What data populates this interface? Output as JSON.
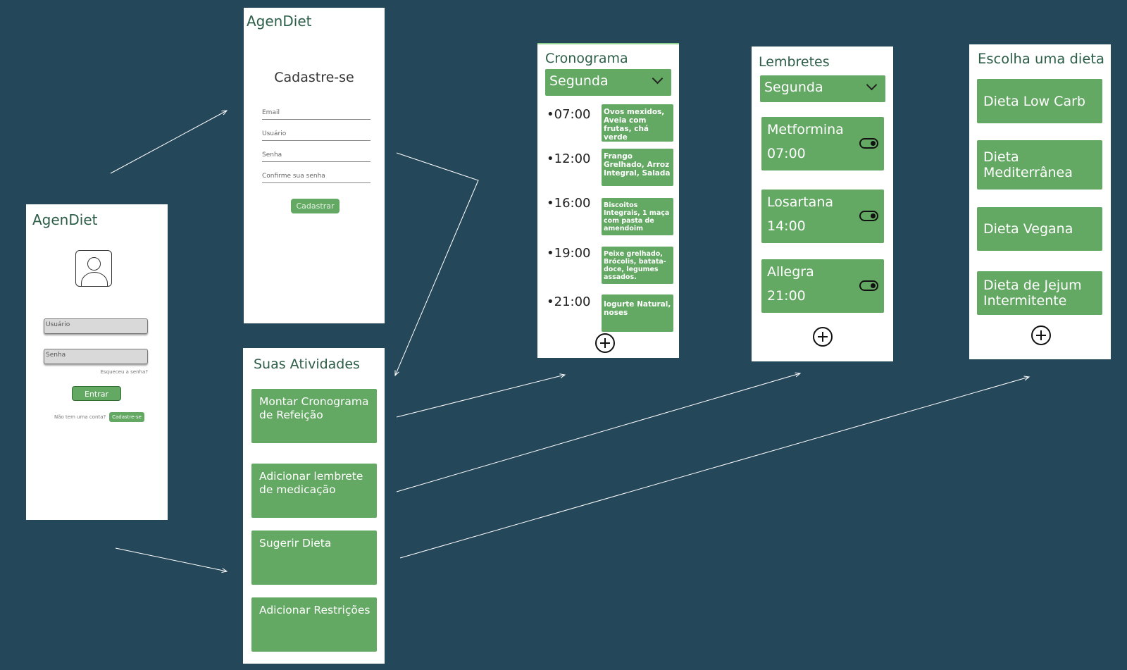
{
  "login": {
    "app_name": "AgenDiet",
    "username_placeholder": "Usuário",
    "password_placeholder": "Senha",
    "forgot_password": "Esqueceu a senha?",
    "login_button": "Entrar",
    "no_account": "Não tem uma conta?",
    "signup_button": "Cadastre-se"
  },
  "cadastro": {
    "app_name": "AgenDiet",
    "heading": "Cadastre-se",
    "fields": [
      "Email",
      "Usuário",
      "Senha",
      "Confirme sua senha"
    ],
    "register_button": "Cadastrar"
  },
  "atividades": {
    "title": "Suas Atividades",
    "items": [
      "Montar Cronograma de Refeição",
      "Adicionar lembrete de medicação",
      "Sugerir Dieta",
      "Adicionar Restrições"
    ]
  },
  "cronograma": {
    "title": "Cronograma",
    "day": "Segunda",
    "entries": [
      {
        "time": "07:00",
        "meal": "Ovos mexidos, Aveia com frutas, chá verde"
      },
      {
        "time": "12:00",
        "meal": "Frango Grelhado, Arroz Integral, Salada"
      },
      {
        "time": "16:00",
        "meal": "Biscoitos Integrais, 1 maça com pasta de amendoim"
      },
      {
        "time": "19:00",
        "meal": "Peixe grelhado, Brócolis, batata-doce, legumes assados."
      },
      {
        "time": "21:00",
        "meal": "Iogurte Natural, noses"
      }
    ]
  },
  "lembretes": {
    "title": "Lembretes",
    "day": "Segunda",
    "items": [
      {
        "name": "Metformina",
        "time": "07:00"
      },
      {
        "name": "Losartana",
        "time": "14:00"
      },
      {
        "name": "Allegra",
        "time": "21:00"
      }
    ]
  },
  "dietas": {
    "title": "Escolha uma dieta",
    "items": [
      "Dieta Low Carb",
      "Dieta Mediterrânea",
      "Dieta Vegana",
      "Dieta de Jejum Intermitente"
    ]
  },
  "colors": {
    "background": "#24475a",
    "accent": "#63a863",
    "title_text": "#2d5e48"
  }
}
